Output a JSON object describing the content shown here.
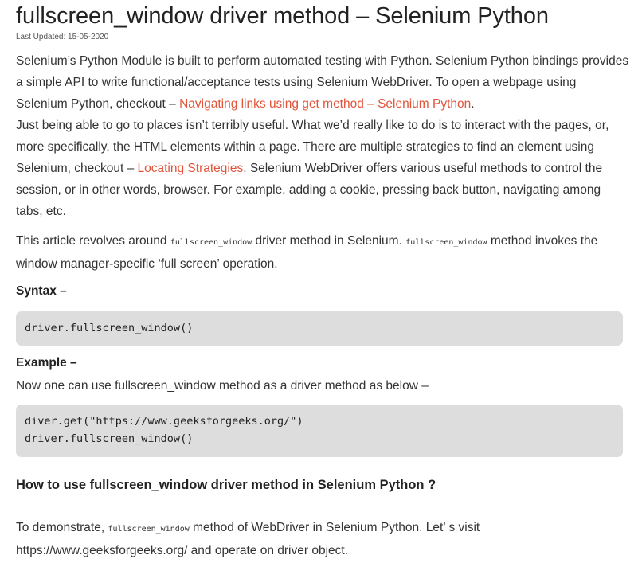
{
  "article": {
    "title": "fullscreen_window driver method – Selenium Python",
    "last_updated": "Last Updated: 15-05-2020",
    "intro": {
      "t1": "Selenium’s Python Module is built to perform automated testing with Python. Selenium Python bindings provides a simple API to write functional/acceptance tests using Selenium WebDriver. To open a webpage using Selenium Python, checkout – ",
      "link1": "Navigating links using get method – Selenium Python",
      "t2": ".",
      "t3": "Just being able to go to places isn’t terribly useful. What we’d really like to do is to interact with the pages, or, more specifically, the HTML elements within a page. There are multiple strategies to find an element using Selenium, checkout – ",
      "link2": "Locating Strategies",
      "t4": ". Selenium WebDriver offers various useful methods to control the session, or in other words, browser. For example, adding a cookie, pressing back button, navigating among tabs, etc."
    },
    "revolves": {
      "t1": "This article revolves around ",
      "code1": "fullscreen_window",
      "t2": " driver method in Selenium. ",
      "code2": "fullscreen_window",
      "t3": " method invokes the window manager-specific ‘full screen’ operation."
    },
    "syntax_heading": "Syntax –",
    "syntax_code": "driver.fullscreen_window()",
    "example_heading": "Example –",
    "example_text": "Now one can use fullscreen_window method as a driver method as below –",
    "example_code": "diver.get(\"https://www.geeksforgeeks.org/\")\ndriver.fullscreen_window()",
    "howto_heading": "How to use fullscreen_window driver method in Selenium Python ?",
    "demo": {
      "t1": "To demonstrate, ",
      "code": "fullscreen_window",
      "t2": " method of WebDriver in Selenium Python. Let’ s visit https://www.geeksforgeeks.org/ and operate on driver object."
    }
  }
}
